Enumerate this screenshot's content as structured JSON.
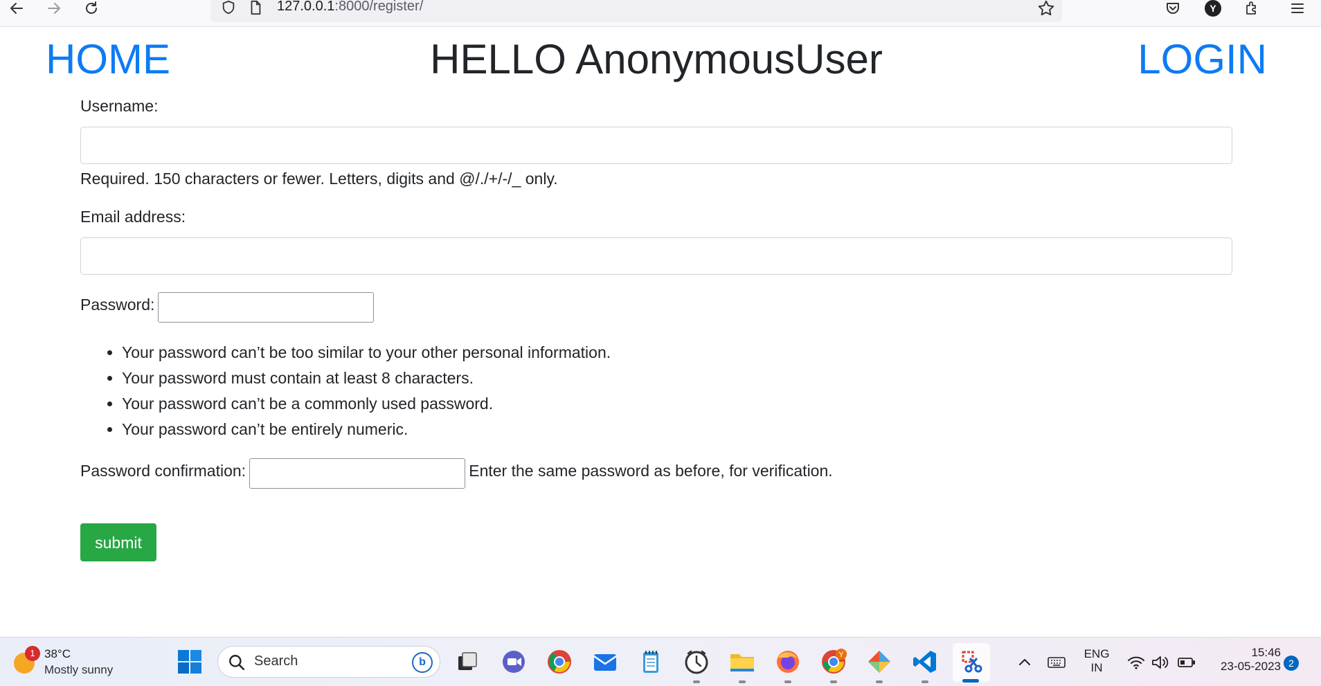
{
  "browser": {
    "url_host": "127.0.0.1",
    "url_path": ":8000/register/"
  },
  "header": {
    "home_label": "HOME",
    "greeting": "HELLO AnonymousUser",
    "login_label": "LOGIN"
  },
  "form": {
    "username_label": "Username:",
    "username_value": "",
    "username_help": "Required. 150 characters or fewer. Letters, digits and @/./+/-/_ only.",
    "email_label": "Email address:",
    "email_value": "",
    "password_label": "Password:",
    "password_value": "",
    "password_rules": [
      "Your password can’t be too similar to your other personal information.",
      "Your password must contain at least 8 characters.",
      "Your password can’t be a commonly used password.",
      "Your password can’t be entirely numeric."
    ],
    "confirm_label": "Password confirmation:",
    "confirm_value": "",
    "confirm_help": "Enter the same password as before, for verification.",
    "submit_label": "submit"
  },
  "taskbar": {
    "weather_badge": "1",
    "weather_temp": "38°C",
    "weather_condition": "Mostly sunny",
    "search_label": "Search",
    "bing_letter": "b",
    "language_line1": "ENG",
    "language_line2": "IN",
    "time": "15:46",
    "date": "23-05-2023",
    "notification_count": "2",
    "chrome_profile_letter": "Y"
  },
  "colors": {
    "link_blue": "#0d7bf3",
    "submit_green": "#28a745",
    "input_border": "#ced4da"
  },
  "icons": {
    "back": "back-arrow-icon",
    "forward": "forward-arrow-icon",
    "reload": "reload-icon",
    "shield": "shield-icon",
    "page": "page-icon",
    "bookmark": "star-icon",
    "pocket": "pocket-icon",
    "profile_letter": "Y",
    "extensions": "extensions-icon",
    "menu": "hamburger-menu-icon"
  }
}
